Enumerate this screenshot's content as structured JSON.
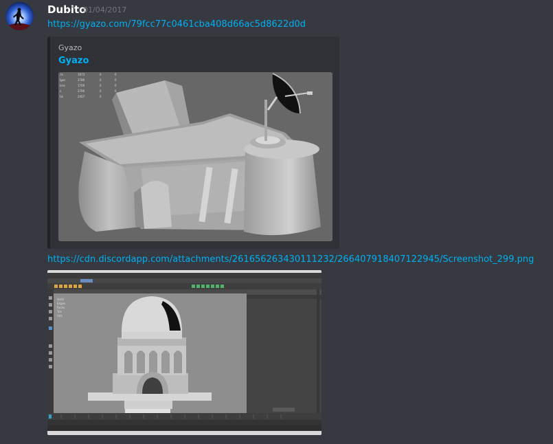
{
  "message": {
    "author": "Dubito",
    "timestamp": "01/04/2017",
    "link_1": "https://gyazo.com/79fcc77c0461cba408d66ac5d8622d0d",
    "embed": {
      "provider": "Gyazo",
      "title": "Gyazo",
      "stats_table": [
        [
          ".ts",
          "1673",
          "0",
          "0"
        ],
        [
          "lges",
          "2780",
          "0",
          "0"
        ],
        [
          "ices",
          "1700",
          "0",
          "0"
        ],
        [
          "s",
          "2796",
          "0",
          "0"
        ],
        [
          "Uv",
          "2407",
          "0",
          "0"
        ]
      ]
    },
    "link_2": "https://cdn.discordapp.com/attachments/261656263430111232/266407918407122945/Screenshot_299.png"
  },
  "colors": {
    "background": "#36393f",
    "embed_bg": "#2f3136",
    "link": "#00b0f4",
    "username": "#ffffff",
    "timestamp": "#72767d"
  },
  "icons": {
    "avatar": "avatar-image"
  }
}
